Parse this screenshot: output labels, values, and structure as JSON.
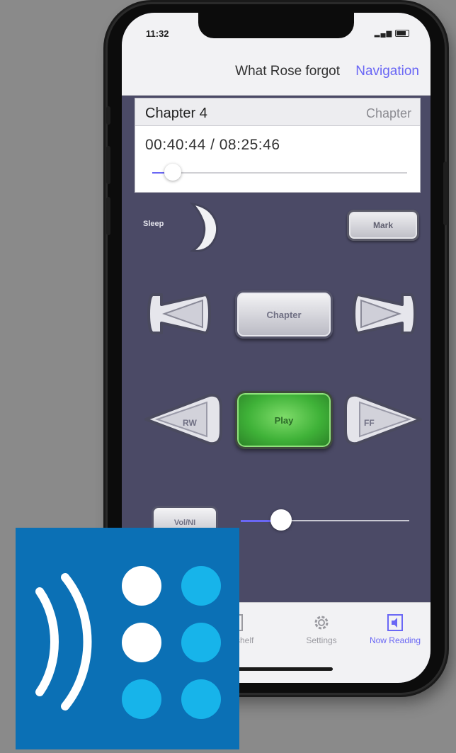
{
  "status_bar": {
    "time": "11:32"
  },
  "navbar": {
    "title": "What Rose forgot",
    "navigation_link": "Navigation"
  },
  "info": {
    "chapter_title": "Chapter 4",
    "chapter_link": "Chapter",
    "time_readout": "00:40:44 / 08:25:46",
    "progress": 0.08
  },
  "controls": {
    "sleep_label": "Sleep",
    "mark_label": "Mark",
    "chapter_label": "Chapter",
    "rw_label": "RW",
    "play_label": "Play",
    "ff_label": "FF",
    "volume_button_label": "Vol/NI",
    "volume_level": 0.24
  },
  "tabbar": {
    "items": [
      {
        "label": "Bookshelf",
        "icon": "book-icon"
      },
      {
        "label": "Settings",
        "icon": "gear-icon"
      },
      {
        "label": "Now Reading",
        "icon": "speaker-book-icon"
      }
    ],
    "active_index": 2
  },
  "colors": {
    "accent": "#6a67f5",
    "play_green": "#3fb238",
    "screen_bg": "#4b4a66",
    "logo_blue": "#0b70b5",
    "logo_cyan": "#17b4ea"
  }
}
